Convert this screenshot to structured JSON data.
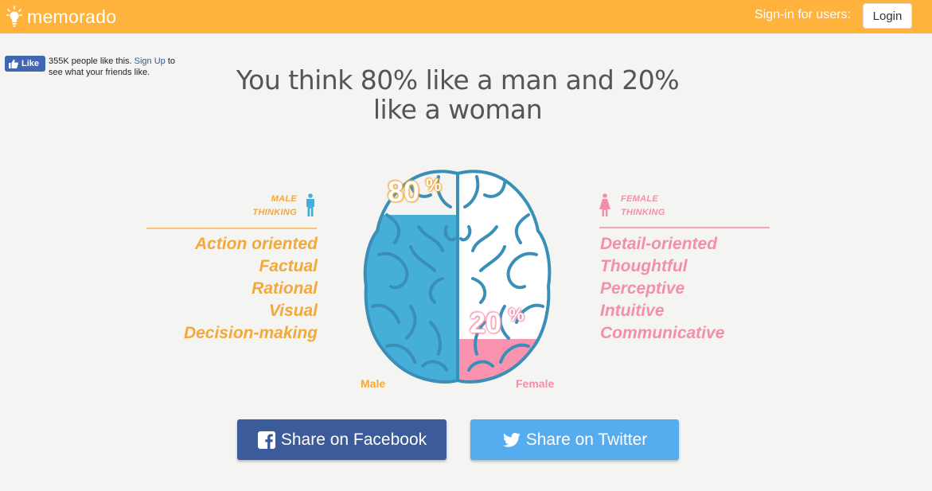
{
  "header": {
    "logo_text": "memorado",
    "signin_text": "Sign-in for users:",
    "login_label": "Login",
    "bar_color": "#ffb23c"
  },
  "fb_widget": {
    "like_label": "Like",
    "count_text": "355K people like this.",
    "signup_link": "Sign Up",
    "suffix_text": "to see what your friends like."
  },
  "result": {
    "title_line1": "You think 80% like a man and 20%",
    "title_line2": "like a woman",
    "male_value": 80,
    "female_value": 20,
    "male_percent_text": "80",
    "female_percent_text": "20",
    "percent_sign": "%"
  },
  "male": {
    "heading_line1": "MALE",
    "heading_line2": "THINKING",
    "traits": [
      "Action oriented",
      "Factual",
      "Rational",
      "Visual",
      "Decision-making"
    ],
    "axis_label": "Male",
    "color": "#f5a83a",
    "icon": "male-person-icon"
  },
  "female": {
    "heading_line1": "FEMALE",
    "heading_line2": "THINKING",
    "traits": [
      "Detail-oriented",
      "Thoughtful",
      "Perceptive",
      "Intuitive",
      "Communicative"
    ],
    "axis_label": "Female",
    "color": "#f48fa9",
    "icon": "female-person-icon"
  },
  "share": {
    "facebook_label": "Share on Facebook",
    "twitter_label": "Share on Twitter",
    "facebook_color": "#3b5b9a",
    "twitter_color": "#55acee"
  }
}
